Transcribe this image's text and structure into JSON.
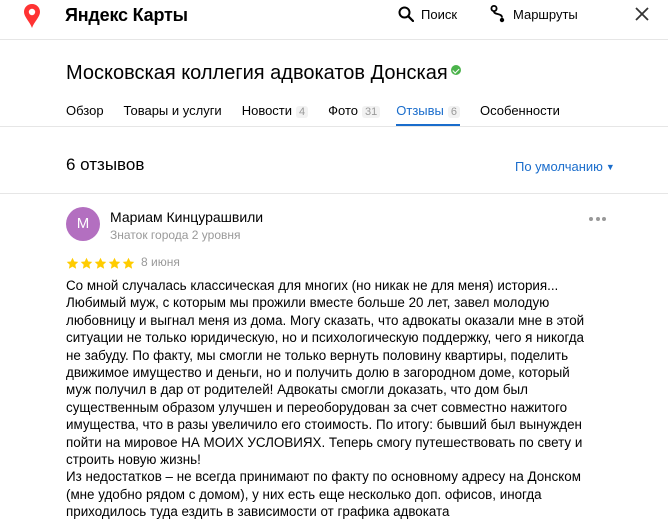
{
  "header": {
    "brand": "Яндекс Карты",
    "search_label": "Поиск",
    "routes_label": "Маршруты",
    "icons": [
      "map-pin-icon",
      "search-icon",
      "routes-icon",
      "close-icon"
    ],
    "pin_color": "#f33"
  },
  "organization": {
    "title": "Московская коллегия адвокатов Донская",
    "verified": true
  },
  "tabs": [
    {
      "label": "Обзор",
      "count": ""
    },
    {
      "label": "Товары и услуги",
      "count": ""
    },
    {
      "label": "Новости",
      "count": "4"
    },
    {
      "label": "Фото",
      "count": "31"
    },
    {
      "label": "Отзывы",
      "count": "6",
      "active": true
    },
    {
      "label": "Особенности",
      "count": ""
    }
  ],
  "reviews": {
    "count_label": "6 отзывов",
    "sort_label": "По умолчанию",
    "accent_color": "#1a6dcc"
  },
  "review": {
    "avatar_letter": "М",
    "avatar_color": "#b36fc0",
    "author": "Мариам Кинцурашвили",
    "level": "Знаток города 2 уровня",
    "rating": 5,
    "date": "8 июня",
    "lines": [
      "Со мной случалась классическая для многих (но никак не для меня) история...",
      "Любимый муж, с которым мы прожили вместе больше 20 лет, завел молодую",
      "любовницу и выгнал меня из дома. Могу сказать, что адвокаты оказали мне в этой",
      "ситуации не только юридическую, но и психологическую поддержку, чего я никогда",
      "не забуду. По факту, мы смогли не только вернуть половину квартиры, поделить",
      "движимое имущество и деньги, но и получить долю в загородном доме, который",
      "муж получил в дар от родителей! Адвокаты смогли доказать, что дом был",
      "существенным образом улучшен и переоборудован за счет совместно нажитого",
      "имущества, что в разы увеличило его стоимость. По итогу: бывший был вынужден",
      "пойти на мировое НА МОИХ УСЛОВИЯХ. Теперь смогу путешествовать по свету и",
      "строить новую жизнь!",
      "Из недостатков – не всегда принимают по факту по основному адресу на Донском",
      "(мне удобно рядом с домом), у них есть еще несколько доп. офисов, иногда",
      "приходилось туда ездить в зависимости от графика адвоката"
    ]
  }
}
